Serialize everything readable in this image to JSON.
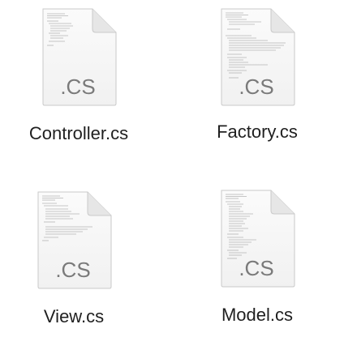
{
  "files": [
    {
      "name": "Controller.cs",
      "extension": ".CS",
      "icon": "cs-document-icon"
    },
    {
      "name": "Factory.cs",
      "extension": ".CS",
      "icon": "cs-document-icon"
    },
    {
      "name": "View.cs",
      "extension": ".CS",
      "icon": "cs-document-icon"
    },
    {
      "name": "Model.cs",
      "extension": ".CS",
      "icon": "cs-document-icon"
    }
  ],
  "colors": {
    "background": "#ffffff",
    "page": "#f7f7f7",
    "page_border": "#c8c8c8",
    "extension_text": "#7a7a7a",
    "label_text": "#1f1f1f"
  }
}
